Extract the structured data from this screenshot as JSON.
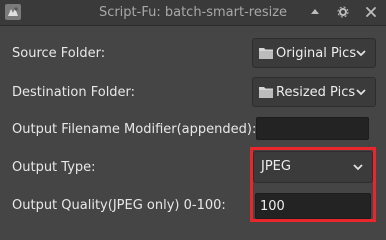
{
  "window": {
    "title": "Script-Fu: batch-smart-resize",
    "icons": {
      "app": "gimp-wilber-icon",
      "maximize": "maximize-icon",
      "settings": "gear-icon",
      "close": "close-icon"
    }
  },
  "form": {
    "source_folder": {
      "label": "Source Folder:",
      "value": "Original Pics",
      "icon": "folder-icon"
    },
    "destination_folder": {
      "label": "Destination Folder:",
      "value": "Resized Pics",
      "icon": "folder-icon"
    },
    "filename_modifier": {
      "label": "Output Filename Modifier(appended):",
      "value": ""
    },
    "output_type": {
      "label": "Output Type:",
      "value": "JPEG"
    },
    "output_quality": {
      "label": "Output Quality(JPEG only) 0-100:",
      "value": "100"
    }
  },
  "colors": {
    "highlight": "#e8262b",
    "background": "#454545",
    "field": "#232323"
  }
}
